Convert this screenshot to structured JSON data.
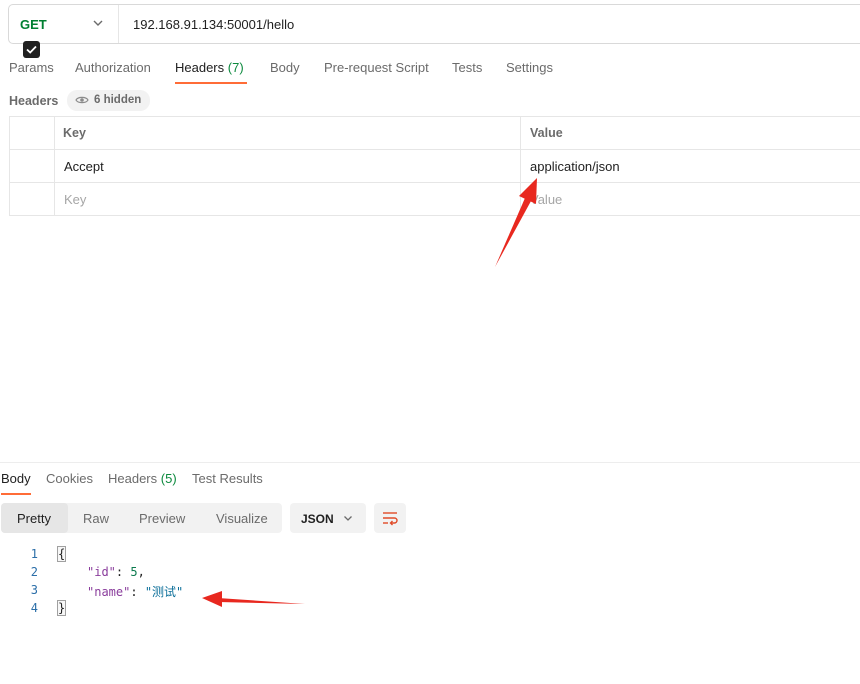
{
  "request": {
    "method": "GET",
    "url": "192.168.91.134:50001/hello"
  },
  "request_tabs": [
    {
      "label": "Params",
      "count": ""
    },
    {
      "label": "Authorization",
      "count": ""
    },
    {
      "label": "Headers",
      "count": "(7)"
    },
    {
      "label": "Body",
      "count": ""
    },
    {
      "label": "Pre-request Script",
      "count": ""
    },
    {
      "label": "Tests",
      "count": ""
    },
    {
      "label": "Settings",
      "count": ""
    }
  ],
  "headers_section": {
    "title": "Headers",
    "hidden_label": "6 hidden",
    "columns": [
      "Key",
      "Value"
    ],
    "rows": [
      {
        "key": "Accept",
        "value": "application/json",
        "checked": true
      }
    ],
    "placeholder": {
      "key": "Key",
      "value": "Value"
    }
  },
  "response_tabs": [
    {
      "label": "Body",
      "count": ""
    },
    {
      "label": "Cookies",
      "count": ""
    },
    {
      "label": "Headers",
      "count": "(5)"
    },
    {
      "label": "Test Results",
      "count": ""
    }
  ],
  "response_view": {
    "modes": [
      "Pretty",
      "Raw",
      "Preview",
      "Visualize"
    ],
    "active_mode": "Pretty",
    "format": "JSON"
  },
  "response_body": {
    "line_numbers": [
      "1",
      "2",
      "3",
      "4"
    ],
    "open_brace": "{",
    "close_brace": "}",
    "fields": [
      {
        "key": "\"id\"",
        "value": "5",
        "trail": ","
      },
      {
        "key": "\"name\"",
        "value": "\"测试\"",
        "trail": ""
      }
    ]
  },
  "colors": {
    "accent": "#ff6c37",
    "method_get": "#007f31",
    "count_green": "#0d8a3e",
    "annotation_red": "#e8281f"
  },
  "icons": {
    "method_dropdown": "chevron-down-icon",
    "hidden_toggle": "eye-icon",
    "checkbox": "checkmark-icon",
    "format_dropdown": "chevron-down-icon",
    "wrap": "wrap-lines-icon"
  }
}
